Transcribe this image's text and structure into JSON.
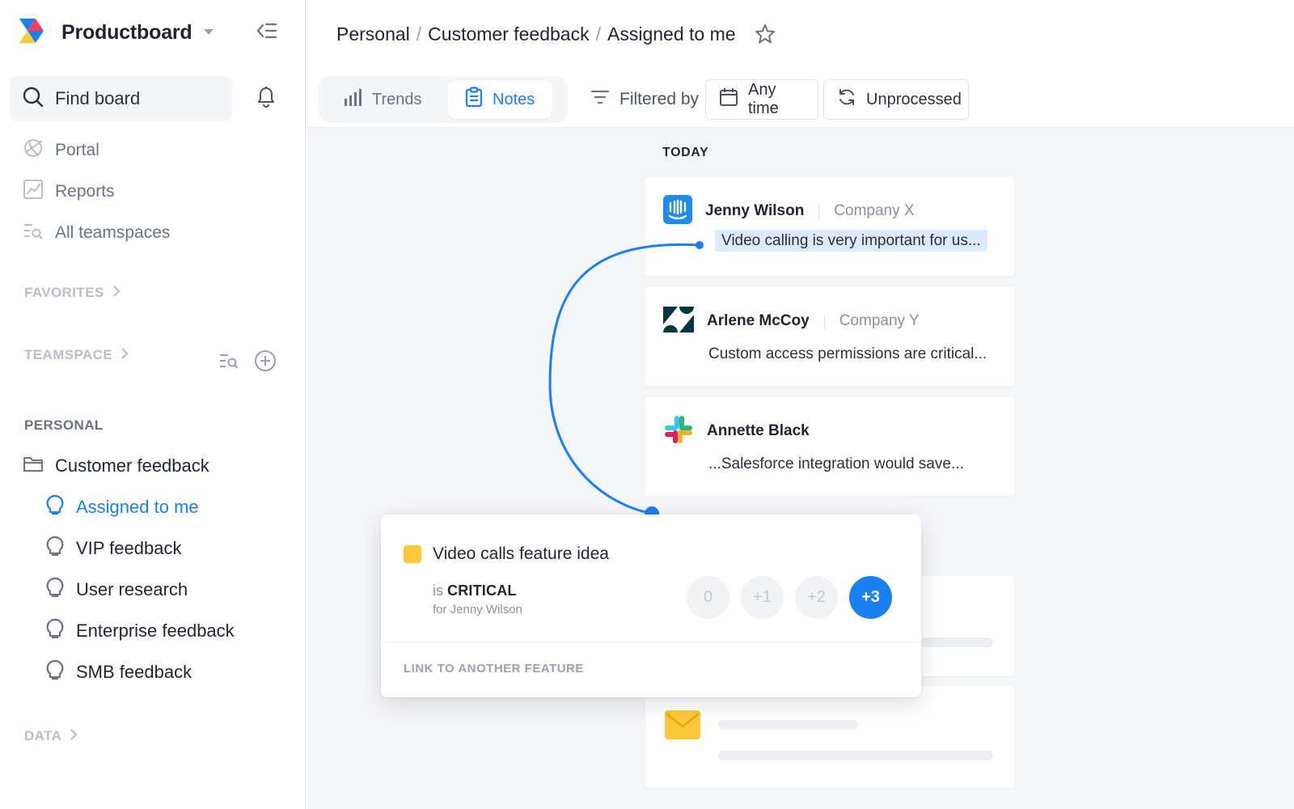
{
  "app": {
    "brand": "Productboard"
  },
  "sidebar": {
    "find_board": "Find board",
    "nav": [
      {
        "label": "Portal",
        "icon": "portal-icon"
      },
      {
        "label": "Reports",
        "icon": "reports-icon"
      },
      {
        "label": "All teamspaces",
        "icon": "teamspaces-icon"
      }
    ],
    "favorites": "FAVORITES",
    "teamspace": "TEAMSPACE",
    "personal": "PERSONAL",
    "folder": "Customer feedback",
    "boards": [
      {
        "label": "Assigned to me",
        "active": true
      },
      {
        "label": "VIP feedback"
      },
      {
        "label": "User research"
      },
      {
        "label": "Enterprise feedback"
      },
      {
        "label": "SMB feedback"
      }
    ],
    "data": "DATA"
  },
  "header": {
    "breadcrumb": [
      "Personal",
      "Customer feedback",
      "Assigned to me"
    ],
    "view_tabs": [
      {
        "label": "Trends",
        "icon": "bar-chart-icon"
      },
      {
        "label": "Notes",
        "icon": "clipboard-icon",
        "active": true
      }
    ],
    "filter_label": "Filtered by",
    "chips": [
      {
        "label": "Any time",
        "icon": "calendar-icon"
      },
      {
        "label": "Unprocessed",
        "icon": "refresh-icon"
      }
    ]
  },
  "feed": {
    "day_label": "TODAY",
    "notes": [
      {
        "author": "Jenny Wilson",
        "company": "Company X",
        "body": "Video calling is very important for us...",
        "source": "intercom-icon"
      },
      {
        "author": "Arlene McCoy",
        "company": "Company Y",
        "body": "Custom access permissions are critical...",
        "source": "zendesk-icon"
      },
      {
        "author": "Annette Black",
        "company": "",
        "body": "...Salesforce integration would save...",
        "source": "slack-icon"
      }
    ]
  },
  "popup": {
    "title": "Video calls feature idea",
    "importance_prefix": "is",
    "importance_value": "CRITICAL",
    "for_text": "for Jenny Wilson",
    "scores": [
      "0",
      "+1",
      "+2",
      "+3"
    ],
    "active_score": "+3",
    "link_label": "LINK TO ANOTHER FEATURE"
  },
  "colors": {
    "accent": "#1a7ff0",
    "feature": "#fbc93a",
    "highlight": "#dbeafc"
  }
}
